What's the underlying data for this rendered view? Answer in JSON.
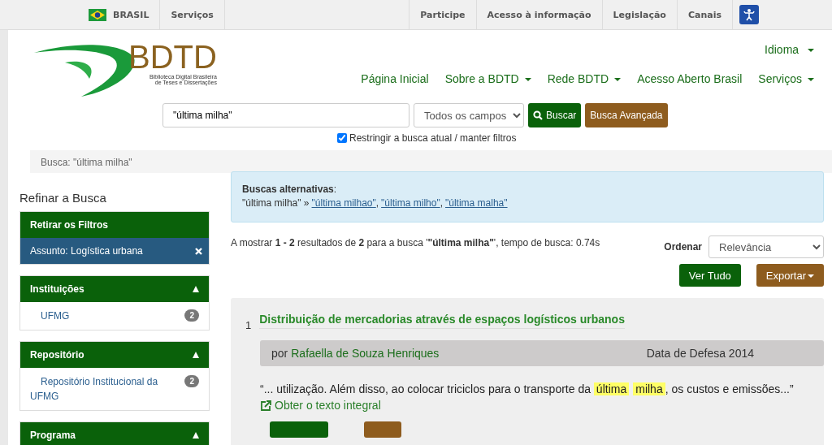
{
  "gov_bar": {
    "country": "BRASIL",
    "left_links": [
      "Serviços"
    ],
    "right_links": [
      "Participe",
      "Acesso à informação",
      "Legislação",
      "Canais"
    ]
  },
  "header": {
    "logo_title": "BDTD",
    "logo_subtitle": [
      "Biblioteca Digital Brasileira",
      "de Teses e Dissertações"
    ],
    "language_menu": "Idioma",
    "nav": [
      {
        "label": "Página Inicial",
        "dropdown": false
      },
      {
        "label": "Sobre a BDTD",
        "dropdown": true
      },
      {
        "label": "Rede BDTD",
        "dropdown": true
      },
      {
        "label": "Acesso Aberto Brasil",
        "dropdown": false
      },
      {
        "label": "Serviços",
        "dropdown": true
      }
    ]
  },
  "search": {
    "value": "\"última milha\"",
    "field": "Todos os campos",
    "search_button": "Buscar",
    "advanced_button": "Busca Avançada",
    "restrict_label": "Restringir a busca atual / manter filtros",
    "restrict_checked": true
  },
  "breadcrumb": "Busca: \"última milha\"",
  "sidebar": {
    "title": "Refinar a Busca",
    "remove_filters": "Retirar os Filtros",
    "active_filters": [
      "Assunto: Logística urbana"
    ],
    "facets": [
      {
        "title": "Instituições",
        "expanded": true,
        "items": [
          {
            "label": "UFMG",
            "count": "2"
          }
        ]
      },
      {
        "title": "Repositório",
        "expanded": true,
        "items": [
          {
            "label": "Repositório Institucional da UFMG",
            "count": "2"
          }
        ]
      },
      {
        "title": "Programa",
        "expanded": true
      }
    ]
  },
  "alternatives": {
    "heading": "**Buscas alternativas**:",
    "current": "\"última milha\" »",
    "links": [
      "\"última milhao\"",
      "\"última milho\"",
      "\"última malha\""
    ],
    "separator": ","
  },
  "results_summary": "A mostrar **1 - 2** resultados de **2** para a busca '**\"última milha\"**', tempo de busca: 0.74s",
  "sort": {
    "label": "Ordenar",
    "value": "Relevância"
  },
  "actions": [
    "Ver Tudo",
    "Exportar"
  ],
  "results": [
    {
      "number": "1",
      "title": "Distribuição de mercadorias através de espaços logísticos urbanos",
      "by": "por",
      "author": "Rafaella de Souza Henriques",
      "date": "Data de Defesa 2014",
      "snippet": [
        {
          "text": "“... utilização. Além disso, ao colocar triciclos para o transporte da ",
          "highlight": false
        },
        {
          "text": "última",
          "highlight": true
        },
        {
          "text": "milha",
          "highlight": true
        },
        {
          "text": ", os custos e emissões...”",
          "highlight": false
        }
      ],
      "fulltext_link": "Obter o texto integral"
    }
  ]
}
